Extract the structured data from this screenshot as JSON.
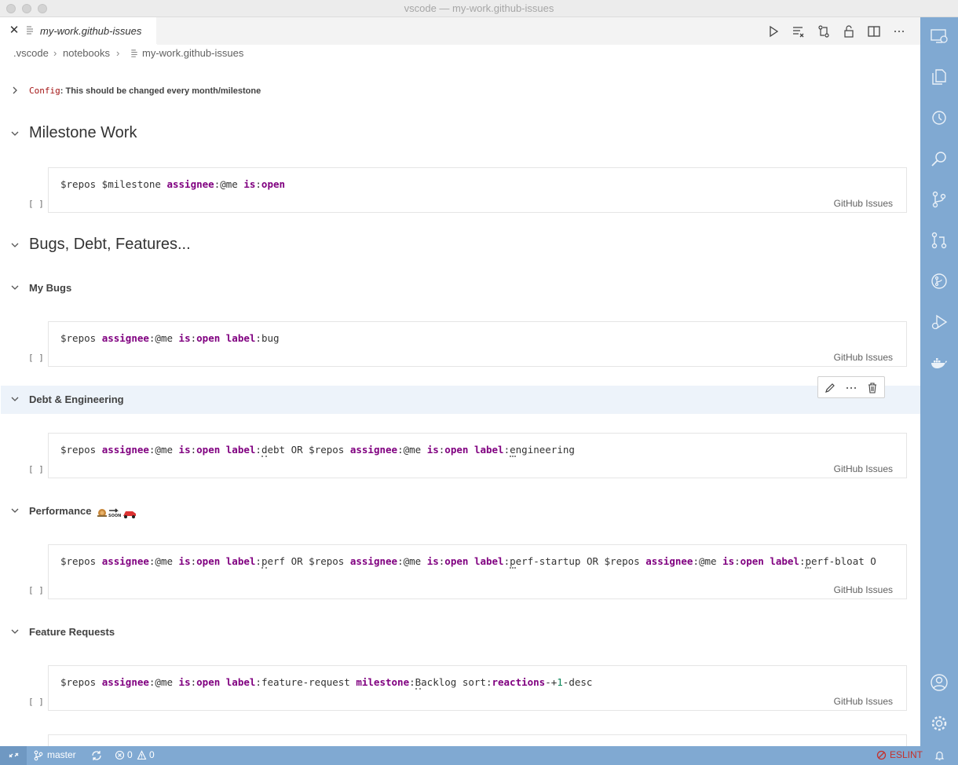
{
  "window": {
    "title": "vscode — my-work.github-issues"
  },
  "tab": {
    "label": "my-work.github-issues"
  },
  "breadcrumb": {
    "part1": ".vscode",
    "part2": "notebooks",
    "part3": "my-work.github-issues"
  },
  "cells": {
    "config": {
      "code": "Config",
      "text": ": This should be changed every month/milestone"
    },
    "h_milestone": "Milestone Work",
    "h_bugs_debt": "Bugs, Debt, Features...",
    "h_my_bugs": "My Bugs",
    "h_debt": "Debt & Engineering",
    "h_perf": "Performance",
    "h_feature": "Feature Requests",
    "lang": "GitHub Issues",
    "exec": "[ ]"
  },
  "statusbar": {
    "branch": "master",
    "errors": "0",
    "warnings": "0",
    "eslint": "ESLINT"
  },
  "colors": {
    "activitybar": "#80a9d2",
    "keyword": "#800080",
    "config_code": "#a31515",
    "hover_row": "#edf3fa"
  },
  "icons": [
    "close-icon",
    "file-icon",
    "run-all-icon",
    "clear-outputs-icon",
    "diff-icon",
    "unlock-icon",
    "split-editor-icon",
    "more-icon",
    "chevron-right-icon",
    "chevron-down-icon",
    "pencil-icon",
    "trash-icon",
    "remote-explorer-icon",
    "files-icon",
    "timeline-icon",
    "search-icon",
    "source-control-icon",
    "pull-request-icon",
    "github-icon",
    "run-debug-icon",
    "docker-icon",
    "account-icon",
    "settings-gear-icon",
    "branch-icon",
    "sync-icon",
    "error-icon",
    "warning-icon",
    "bell-icon"
  ]
}
